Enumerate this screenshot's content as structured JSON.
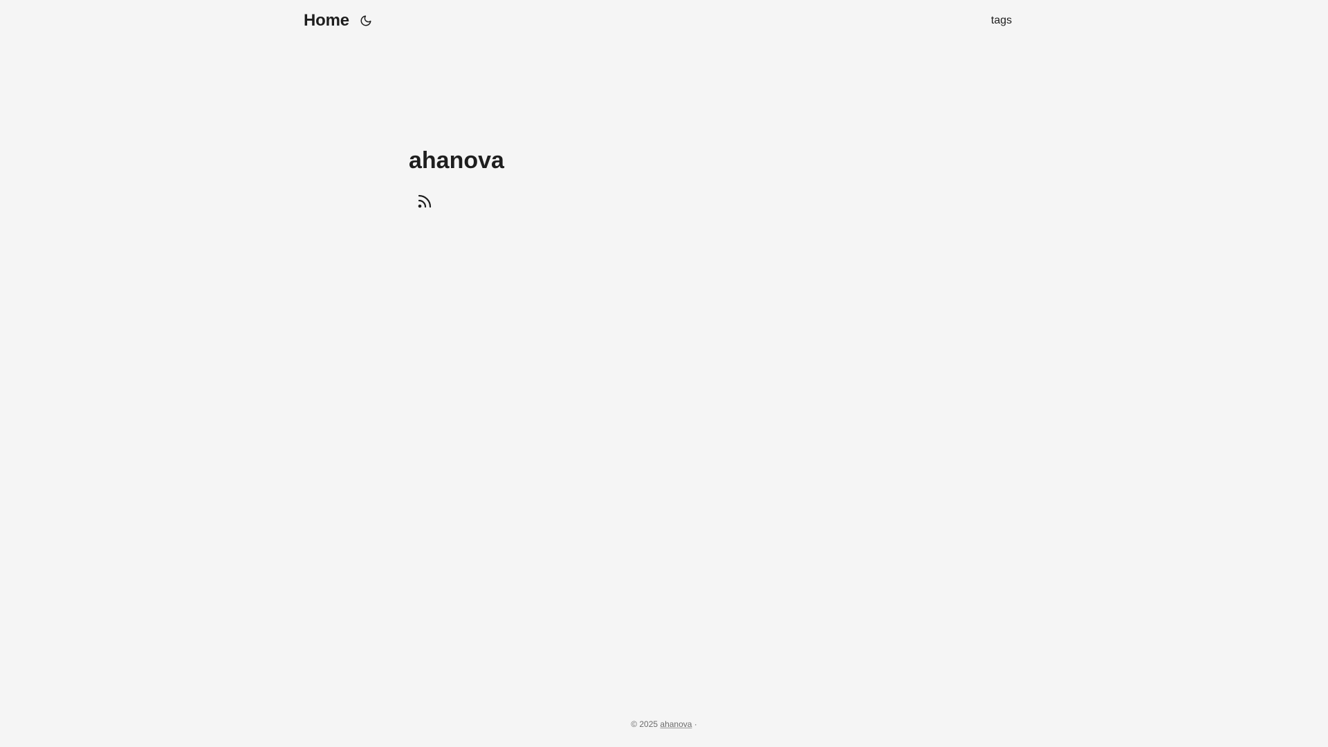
{
  "header": {
    "home_label": "Home",
    "theme_icon": "moon-icon",
    "menu": [
      {
        "label": "tags"
      }
    ]
  },
  "profile": {
    "title": "ahanova",
    "social_icons": [
      {
        "name": "rss-icon"
      }
    ]
  },
  "footer": {
    "copyright_prefix": "© 2025",
    "author_link": "ahanova",
    "separator": "·"
  }
}
